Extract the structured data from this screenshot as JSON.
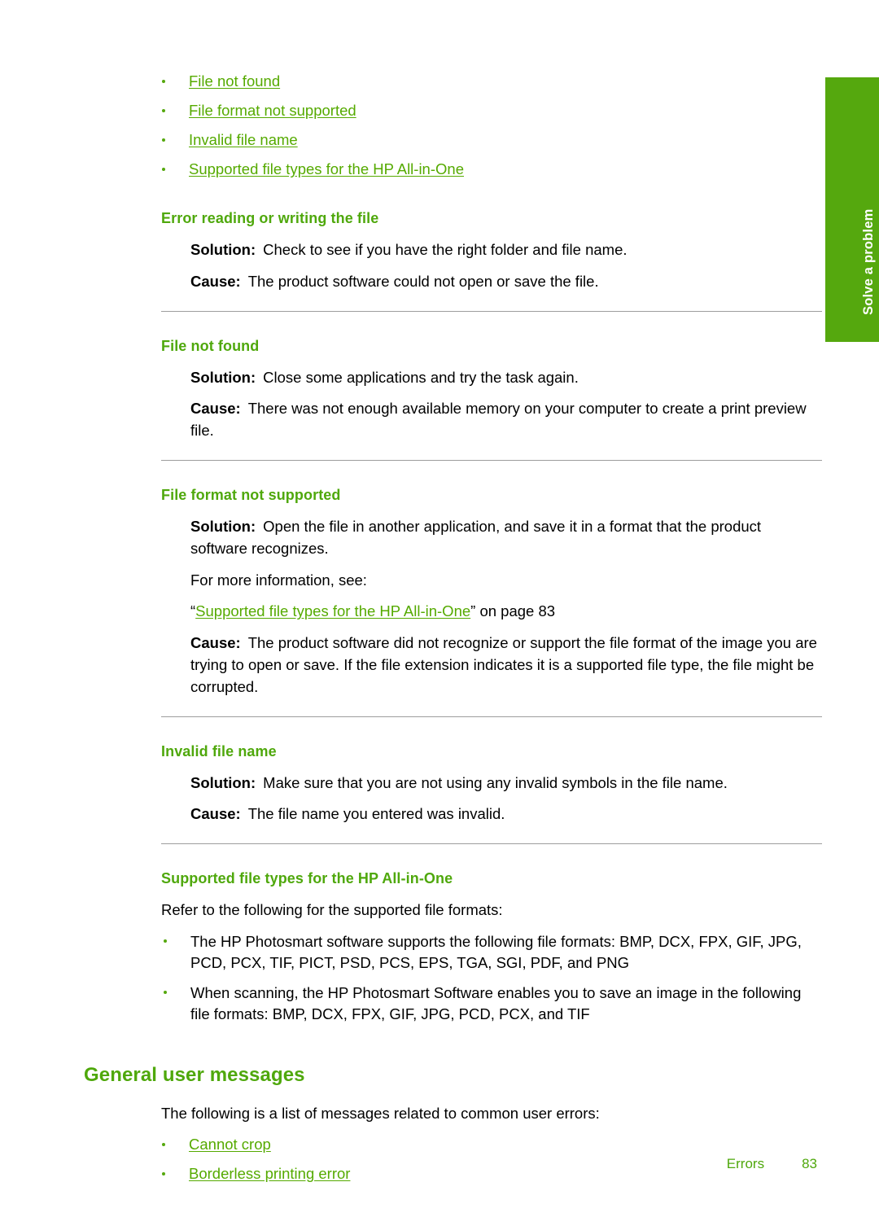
{
  "side_tab": {
    "label": "Solve a problem",
    "color": "#55a80e"
  },
  "colors": {
    "heading_green": "#4fa80c",
    "link_green": "#55aa00",
    "rule_gray": "#9d9d9d"
  },
  "top_links": [
    "File not found",
    "File format not supported",
    "Invalid file name",
    "Supported file types for the HP All-in-One"
  ],
  "sections": [
    {
      "heading": "Error reading or writing the file",
      "solution_label": "Solution:",
      "solution_text": "Check to see if you have the right folder and file name.",
      "cause_label": "Cause:",
      "cause_text": "The product software could not open or save the file."
    },
    {
      "heading": "File not found",
      "solution_label": "Solution:",
      "solution_text": "Close some applications and try the task again.",
      "cause_label": "Cause:",
      "cause_text": "There was not enough available memory on your computer to create a print preview file."
    },
    {
      "heading": "File format not supported",
      "solution_label": "Solution:",
      "solution_text": "Open the file in another application, and save it in a format that the product software recognizes.",
      "more_info": "For more information, see:",
      "xref_open_quote": "“",
      "xref_link": "Supported file types for the HP All-in-One",
      "xref_close_quote": "”",
      "xref_tail": " on page 83",
      "cause_label": "Cause:",
      "cause_text": "The product software did not recognize or support the file format of the image you are trying to open or save. If the file extension indicates it is a supported file type, the file might be corrupted."
    },
    {
      "heading": "Invalid file name",
      "solution_label": "Solution:",
      "solution_text": "Make sure that you are not using any invalid symbols in the file name.",
      "cause_label": "Cause:",
      "cause_text": "The file name you entered was invalid."
    }
  ],
  "supported_types": {
    "heading": "Supported file types for the HP All-in-One",
    "intro": "Refer to the following for the supported file formats:",
    "bullets": [
      "The HP Photosmart software supports the following file formats: BMP, DCX, FPX, GIF, JPG, PCD, PCX, TIF, PICT, PSD, PCS, EPS, TGA, SGI, PDF, and PNG",
      "When scanning, the HP Photosmart Software enables you to save an image in the following file formats: BMP, DCX, FPX, GIF, JPG, PCD, PCX, and TIF"
    ]
  },
  "general_user_messages": {
    "heading": "General user messages",
    "intro": "The following is a list of messages related to common user errors:",
    "links": [
      "Cannot crop",
      "Borderless printing error"
    ]
  },
  "footer": {
    "chapter": "Errors",
    "page_number": "83"
  }
}
